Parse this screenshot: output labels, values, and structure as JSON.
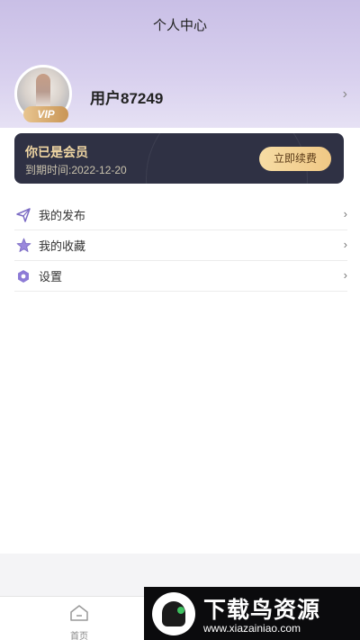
{
  "header": {
    "title": "个人中心"
  },
  "user": {
    "name": "用户87249",
    "vip_badge": "VIP",
    "chevron": "›"
  },
  "member": {
    "status": "你已是会员",
    "expire": "到期时间:2022-12-20",
    "renew_label": "立即续费"
  },
  "menu": {
    "items": [
      {
        "label": "我的发布",
        "icon": "send-icon",
        "chevron": "›"
      },
      {
        "label": "我的收藏",
        "icon": "star-icon",
        "chevron": "›"
      },
      {
        "label": "设置",
        "icon": "settings-icon",
        "chevron": "›"
      }
    ]
  },
  "tabbar": {
    "home_label": "首页"
  },
  "watermark": {
    "title": "下载鸟资源",
    "url": "www.xiazainiao.com"
  },
  "colors": {
    "accent": "#7b6bc4",
    "card_bg": "#2f3144",
    "gold": "#f0d6a3"
  }
}
